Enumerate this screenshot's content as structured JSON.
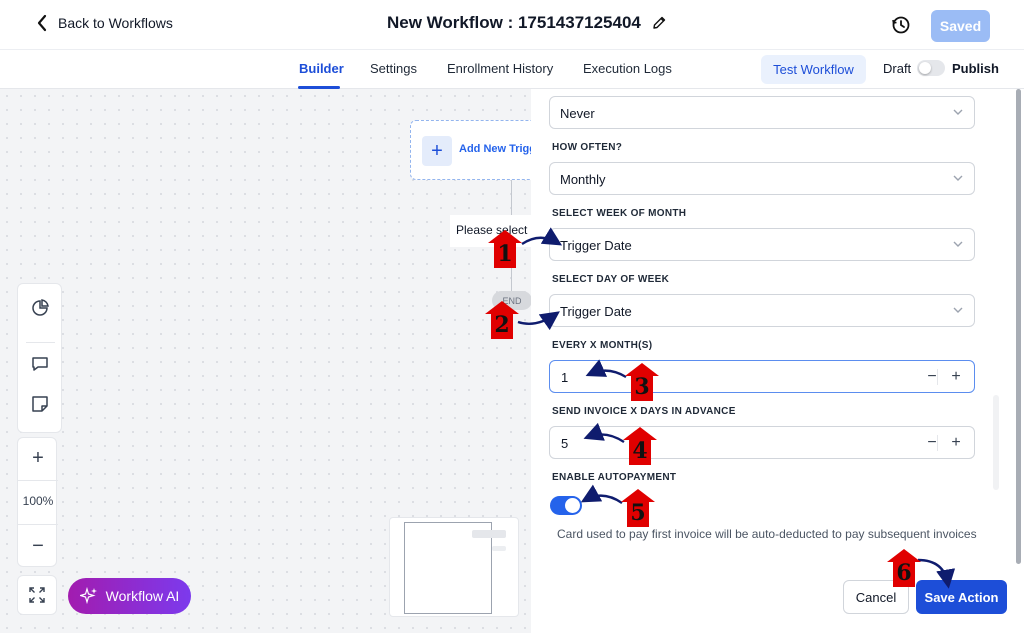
{
  "header": {
    "back_label": "Back to Workflows",
    "title": "New Workflow : 1751437125404",
    "saved_label": "Saved"
  },
  "tabs": {
    "items": [
      "Builder",
      "Settings",
      "Enrollment History",
      "Execution Logs"
    ],
    "active": "Builder",
    "test_label": "Test Workflow",
    "draft_label": "Draft",
    "publish_label": "Publish"
  },
  "canvas": {
    "trigger_label": "Add New Trigger",
    "please_select": "Please select",
    "end_label": "END",
    "zoom_level": "100%",
    "ai_label": "Workflow AI"
  },
  "panel": {
    "never_value": "Never",
    "how_often_label": "HOW OFTEN?",
    "how_often_value": "Monthly",
    "week_label": "SELECT WEEK OF MONTH",
    "week_value": "Trigger Date",
    "day_label": "SELECT DAY OF WEEK",
    "day_value": "Trigger Date",
    "every_label": "EVERY X MONTH(S)",
    "every_value": "1",
    "advance_label": "SEND INVOICE X DAYS IN ADVANCE",
    "advance_value": "5",
    "autopay_label": "ENABLE AUTOPAYMENT",
    "autopay_on": true,
    "autopay_help": "Card used to pay first invoice will be auto-deducted to pay subsequent invoices",
    "cancel_label": "Cancel",
    "save_label": "Save Action"
  },
  "annotations": [
    "1",
    "2",
    "3",
    "4",
    "5",
    "6"
  ],
  "colors": {
    "accent": "#1d4ed8",
    "badge": "#e00000",
    "arrow": "#0f1c6e"
  }
}
